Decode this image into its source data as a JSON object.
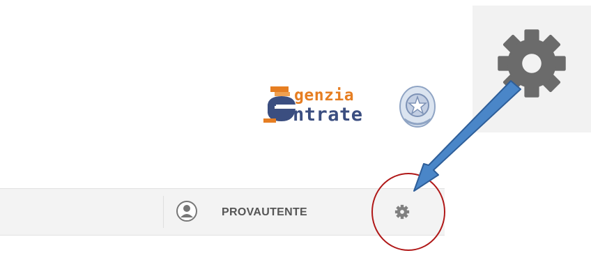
{
  "logo": {
    "line1": "genzia",
    "line2": "ntrate"
  },
  "user": {
    "username": "PROVAUTENTE"
  },
  "icons": {
    "settings_zoomed": "gear-icon",
    "user": "user-circle-icon",
    "settings": "gear-icon"
  },
  "annotation": {
    "arrow_color": "#4a86c8",
    "circle_color": "#b01818"
  },
  "colors": {
    "logo_orange": "#e67e22",
    "logo_blue": "#3b4e80",
    "toolbar_bg": "#f3f3f3",
    "gear_gray": "#6b6b6b"
  }
}
